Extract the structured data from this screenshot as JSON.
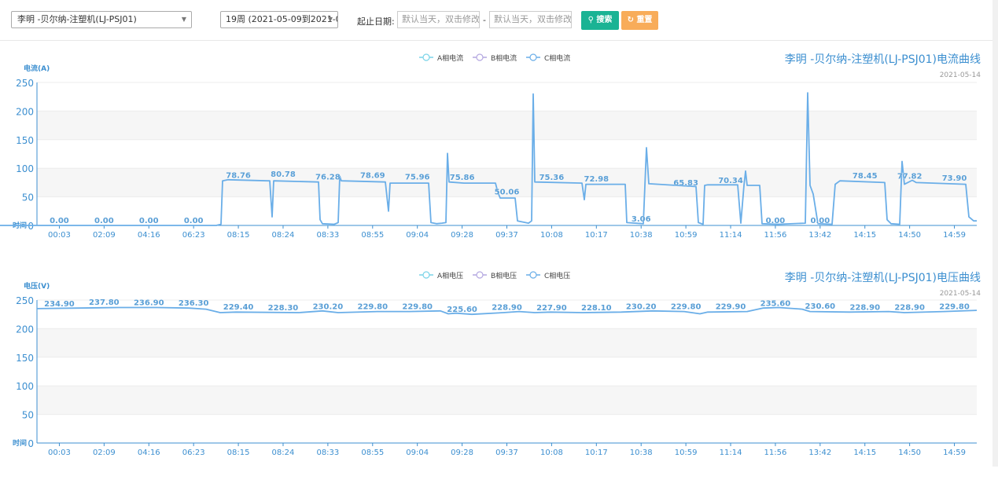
{
  "toolbar": {
    "device_select": "李明 -贝尔纳-注塑机(LJ-PSJ01)",
    "week_select": "19周 (2021-05-09到2021-0...",
    "date_range_label": "起止日期:",
    "start_placeholder": "默认当天，双击修改",
    "end_placeholder": "默认当天，双击修改",
    "range_separator": "-",
    "search_label": "搜索",
    "reset_label": "重置"
  },
  "chart_data": [
    {
      "type": "line",
      "title": "李明  -贝尔纳-注塑机(LJ-PSJ01)电流曲线",
      "subtitle": "2021-05-14",
      "ylabel": "电流(A)",
      "xlabel": "时间",
      "ylim": [
        0,
        250
      ],
      "yticks": [
        0,
        50,
        100,
        150,
        200,
        250
      ],
      "x_labels": [
        "00:03",
        "02:09",
        "04:16",
        "06:23",
        "08:15",
        "08:24",
        "08:33",
        "08:55",
        "09:04",
        "09:28",
        "09:37",
        "10:08",
        "10:17",
        "10:38",
        "10:59",
        "11:14",
        "11:56",
        "13:42",
        "14:15",
        "14:50",
        "14:59"
      ],
      "legend": [
        "A相电流",
        "B相电流",
        "C相电流"
      ],
      "legend_colors": [
        "#7ad4e8",
        "#b4a7e0",
        "#6aaee8"
      ],
      "grid": true,
      "series": [
        {
          "name": "C相电流",
          "points": [
            [
              0,
              0
            ],
            [
              95,
              0
            ],
            [
              275,
              0
            ],
            [
              281,
              2
            ],
            [
              283,
              78
            ],
            [
              290,
              80
            ],
            [
              340,
              78
            ],
            [
              343,
              78
            ],
            [
              346,
              15
            ],
            [
              348,
              78
            ],
            [
              405,
              76
            ],
            [
              407,
              10
            ],
            [
              410,
              3
            ],
            [
              425,
              2
            ],
            [
              430,
              5
            ],
            [
              432,
              86
            ],
            [
              434,
              78
            ],
            [
              490,
              76
            ],
            [
              494,
              25
            ],
            [
              496,
              74
            ],
            [
              545,
              74
            ],
            [
              548,
              5
            ],
            [
              555,
              3
            ],
            [
              562,
              4
            ],
            [
              567,
              5
            ],
            [
              569,
              126
            ],
            [
              571,
              76
            ],
            [
              590,
              74
            ],
            [
              630,
              74
            ],
            [
              633,
              58
            ],
            [
              636,
              48
            ],
            [
              655,
              48
            ],
            [
              658,
              8
            ],
            [
              672,
              4
            ],
            [
              676,
              8
            ],
            [
              678,
              230
            ],
            [
              680,
              76
            ],
            [
              740,
              74
            ],
            [
              743,
              45
            ],
            [
              745,
              72
            ],
            [
              795,
              72
            ],
            [
              797,
              5
            ],
            [
              818,
              3
            ],
            [
              822,
              136
            ],
            [
              825,
              73
            ],
            [
              860,
              70
            ],
            [
              885,
              68
            ],
            [
              888,
              5
            ],
            [
              894,
              2
            ],
            [
              896,
              70
            ],
            [
              900,
              71
            ],
            [
              938,
              71
            ],
            [
              942,
              4
            ],
            [
              946,
              70
            ],
            [
              948,
              95
            ],
            [
              950,
              70
            ],
            [
              966,
              70
            ],
            [
              969,
              3
            ],
            [
              990,
              2
            ],
            [
              1024,
              4
            ],
            [
              1027,
              232
            ],
            [
              1030,
              70
            ],
            [
              1034,
              55
            ],
            [
              1040,
              3
            ],
            [
              1058,
              2
            ],
            [
              1062,
              72
            ],
            [
              1068,
              78
            ],
            [
              1125,
              75
            ],
            [
              1128,
              10
            ],
            [
              1133,
              3
            ],
            [
              1144,
              2
            ],
            [
              1147,
              112
            ],
            [
              1150,
              72
            ],
            [
              1160,
              79
            ],
            [
              1165,
              75
            ],
            [
              1228,
              72
            ],
            [
              1232,
              15
            ],
            [
              1238,
              8
            ],
            [
              1242,
              8
            ]
          ]
        }
      ],
      "data_labels": [
        {
          "x": "00:03",
          "y": 0.0,
          "text": "0.00"
        },
        {
          "x": "02:09",
          "y": 0.0,
          "text": "0.00"
        },
        {
          "x": "04:16",
          "y": 0.0,
          "text": "0.00"
        },
        {
          "x": "06:23",
          "y": 0.0,
          "text": "0.00"
        },
        {
          "x": "08:15",
          "y": 78.76,
          "text": "78.76"
        },
        {
          "x": "08:24",
          "y": 80.78,
          "text": "80.78"
        },
        {
          "x": "08:33",
          "y": 76.28,
          "text": "76.28"
        },
        {
          "x": "08:55",
          "y": 78.69,
          "text": "78.69"
        },
        {
          "x": "09:04",
          "y": 75.96,
          "text": "75.96"
        },
        {
          "x": "09:28",
          "y": 75.86,
          "text": "75.86"
        },
        {
          "x": "09:37",
          "y": 50.06,
          "text": "50.06"
        },
        {
          "x": "10:08",
          "y": 75.36,
          "text": "75.36"
        },
        {
          "x": "10:17",
          "y": 72.98,
          "text": "72.98"
        },
        {
          "x": "10:38",
          "y": 3.06,
          "text": "3.06"
        },
        {
          "x": "10:59",
          "y": 65.83,
          "text": "65.83"
        },
        {
          "x": "11:14",
          "y": 70.34,
          "text": "70.34"
        },
        {
          "x": "11:56",
          "y": 0.0,
          "text": "0.00"
        },
        {
          "x": "13:42",
          "y": 0.0,
          "text": "0.00"
        },
        {
          "x": "14:15",
          "y": 78.45,
          "text": "78.45"
        },
        {
          "x": "14:50",
          "y": 77.82,
          "text": "77.82"
        },
        {
          "x": "14:59",
          "y": 73.9,
          "text": "73.90"
        }
      ]
    },
    {
      "type": "line",
      "title": "李明  -贝尔纳-注塑机(LJ-PSJ01)电压曲线",
      "subtitle": "2021-05-14",
      "ylabel": "电压(V)",
      "xlabel": "时间",
      "ylim": [
        0,
        250
      ],
      "yticks": [
        0,
        50,
        100,
        150,
        200,
        250
      ],
      "x_labels": [
        "00:03",
        "02:09",
        "04:16",
        "06:23",
        "08:15",
        "08:24",
        "08:33",
        "08:55",
        "09:04",
        "09:28",
        "09:37",
        "10:08",
        "10:17",
        "10:38",
        "10:59",
        "11:14",
        "11:56",
        "13:42",
        "14:15",
        "14:50",
        "14:59"
      ],
      "legend": [
        "A相电压",
        "B相电压",
        "C相电压"
      ],
      "legend_colors": [
        "#7ad4e8",
        "#b4a7e0",
        "#6aaee8"
      ],
      "grid": true,
      "series": [
        {
          "name": "C相电压",
          "points": [
            [
              47,
              235
            ],
            [
              100,
              236
            ],
            [
              150,
              237
            ],
            [
              200,
              237
            ],
            [
              240,
              236
            ],
            [
              262,
              234
            ],
            [
              280,
              228
            ],
            [
              300,
              229
            ],
            [
              380,
              228
            ],
            [
              410,
              231
            ],
            [
              430,
              228
            ],
            [
              480,
              230
            ],
            [
              520,
              230
            ],
            [
              560,
              231
            ],
            [
              570,
              226
            ],
            [
              580,
              227
            ],
            [
              600,
              225
            ],
            [
              640,
              228
            ],
            [
              660,
              230
            ],
            [
              680,
              228
            ],
            [
              700,
              229
            ],
            [
              740,
              228
            ],
            [
              790,
              229
            ],
            [
              830,
              231
            ],
            [
              870,
              230
            ],
            [
              890,
              226
            ],
            [
              900,
              229
            ],
            [
              950,
              230
            ],
            [
              970,
              236
            ],
            [
              990,
              237
            ],
            [
              1020,
              234
            ],
            [
              1030,
              230
            ],
            [
              1080,
              229
            ],
            [
              1130,
              230
            ],
            [
              1150,
              228
            ],
            [
              1200,
              230
            ],
            [
              1242,
              232
            ]
          ]
        }
      ],
      "data_labels": [
        {
          "x": "00:03",
          "y": 234.9,
          "text": "234.90"
        },
        {
          "x": "02:09",
          "y": 237.8,
          "text": "237.80"
        },
        {
          "x": "04:16",
          "y": 236.9,
          "text": "236.90"
        },
        {
          "x": "06:23",
          "y": 236.3,
          "text": "236.30"
        },
        {
          "x": "08:15",
          "y": 229.4,
          "text": "229.40"
        },
        {
          "x": "08:24",
          "y": 228.3,
          "text": "228.30"
        },
        {
          "x": "08:33",
          "y": 230.2,
          "text": "230.20"
        },
        {
          "x": "08:55",
          "y": 229.8,
          "text": "229.80"
        },
        {
          "x": "09:04",
          "y": 229.8,
          "text": "229.80"
        },
        {
          "x": "09:28",
          "y": 225.6,
          "text": "225.60"
        },
        {
          "x": "09:37",
          "y": 228.9,
          "text": "228.90"
        },
        {
          "x": "10:08",
          "y": 227.9,
          "text": "227.90"
        },
        {
          "x": "10:17",
          "y": 228.1,
          "text": "228.10"
        },
        {
          "x": "10:38",
          "y": 230.2,
          "text": "230.20"
        },
        {
          "x": "10:59",
          "y": 229.8,
          "text": "229.80"
        },
        {
          "x": "11:14",
          "y": 229.9,
          "text": "229.90"
        },
        {
          "x": "11:56",
          "y": 235.6,
          "text": "235.60"
        },
        {
          "x": "13:42",
          "y": 230.6,
          "text": "230.60"
        },
        {
          "x": "14:15",
          "y": 228.9,
          "text": "228.90"
        },
        {
          "x": "14:50",
          "y": 228.9,
          "text": "228.90"
        },
        {
          "x": "14:59",
          "y": 229.8,
          "text": "229.80"
        }
      ]
    }
  ]
}
